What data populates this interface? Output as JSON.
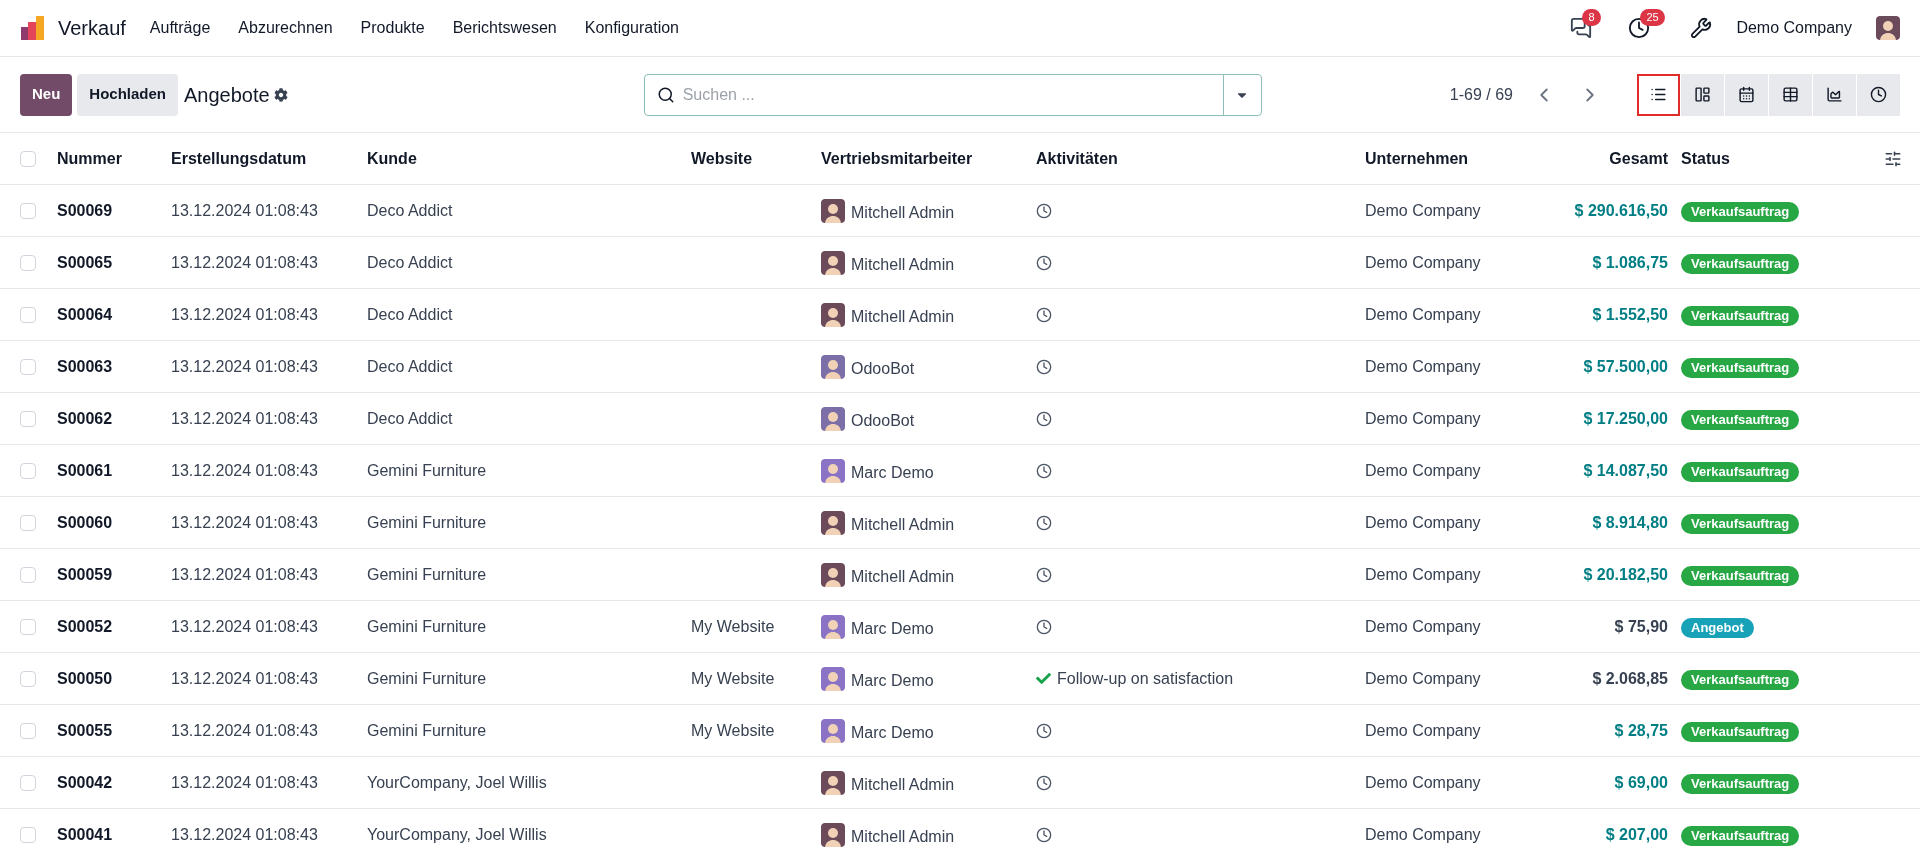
{
  "navbar": {
    "app_name": "Verkauf",
    "menu": [
      "Aufträge",
      "Abzurechnen",
      "Produkte",
      "Berichtswesen",
      "Konfiguration"
    ],
    "messages_badge": "8",
    "activities_badge": "25",
    "company": "Demo Company"
  },
  "control_panel": {
    "new_button": "Neu",
    "upload_button": "Hochladen",
    "title": "Angebote",
    "search": {
      "placeholder": "Suchen ..."
    },
    "pager": "1-69 / 69",
    "views": [
      {
        "kind": "list",
        "selected": true
      },
      {
        "kind": "kanban",
        "selected": false
      },
      {
        "kind": "calendar",
        "selected": false
      },
      {
        "kind": "pivot",
        "selected": false
      },
      {
        "kind": "graph",
        "selected": false
      },
      {
        "kind": "activity",
        "selected": false
      }
    ]
  },
  "table": {
    "select_all": {
      "checked": false
    },
    "columns": [
      "Nummer",
      "Erstellungsdatum",
      "Kunde",
      "Website",
      "Vertriebsmitarbeiter",
      "Aktivitäten",
      "Unternehmen",
      "Gesamt",
      "Status"
    ],
    "rows": [
      {
        "checked": false,
        "number": "S00069",
        "date": "13.12.2024 01:08:43",
        "customer": "Deco Addict",
        "website": "",
        "salesperson": "Mitchell Admin",
        "color": "#6b4a5a",
        "activity": {
          "kind": "clock"
        },
        "company": "Demo Company",
        "total": "$ 290.616,50",
        "highlighted": true,
        "status": {
          "kind": "sale",
          "label": "Verkaufsauftrag"
        }
      },
      {
        "checked": false,
        "number": "S00065",
        "date": "13.12.2024 01:08:43",
        "customer": "Deco Addict",
        "website": "",
        "salesperson": "Mitchell Admin",
        "color": "#6b4a5a",
        "activity": {
          "kind": "clock"
        },
        "company": "Demo Company",
        "total": "$ 1.086,75",
        "highlighted": true,
        "status": {
          "kind": "sale",
          "label": "Verkaufsauftrag"
        }
      },
      {
        "checked": false,
        "number": "S00064",
        "date": "13.12.2024 01:08:43",
        "customer": "Deco Addict",
        "website": "",
        "salesperson": "Mitchell Admin",
        "color": "#6b4a5a",
        "activity": {
          "kind": "clock"
        },
        "company": "Demo Company",
        "total": "$ 1.552,50",
        "highlighted": true,
        "status": {
          "kind": "sale",
          "label": "Verkaufsauftrag"
        }
      },
      {
        "checked": false,
        "number": "S00063",
        "date": "13.12.2024 01:08:43",
        "customer": "Deco Addict",
        "website": "",
        "salesperson": "OdooBot",
        "color": "#7c6fa8",
        "activity": {
          "kind": "clock"
        },
        "company": "Demo Company",
        "total": "$ 57.500,00",
        "highlighted": true,
        "status": {
          "kind": "sale",
          "label": "Verkaufsauftrag"
        }
      },
      {
        "checked": false,
        "number": "S00062",
        "date": "13.12.2024 01:08:43",
        "customer": "Deco Addict",
        "website": "",
        "salesperson": "OdooBot",
        "color": "#7c6fa8",
        "activity": {
          "kind": "clock"
        },
        "company": "Demo Company",
        "total": "$ 17.250,00",
        "highlighted": true,
        "status": {
          "kind": "sale",
          "label": "Verkaufsauftrag"
        }
      },
      {
        "checked": false,
        "number": "S00061",
        "date": "13.12.2024 01:08:43",
        "customer": "Gemini Furniture",
        "website": "",
        "salesperson": "Marc Demo",
        "color": "#8a72c4",
        "activity": {
          "kind": "clock"
        },
        "company": "Demo Company",
        "total": "$ 14.087,50",
        "highlighted": true,
        "status": {
          "kind": "sale",
          "label": "Verkaufsauftrag"
        }
      },
      {
        "checked": false,
        "number": "S00060",
        "date": "13.12.2024 01:08:43",
        "customer": "Gemini Furniture",
        "website": "",
        "salesperson": "Mitchell Admin",
        "color": "#6b4a5a",
        "activity": {
          "kind": "clock"
        },
        "company": "Demo Company",
        "total": "$ 8.914,80",
        "highlighted": true,
        "status": {
          "kind": "sale",
          "label": "Verkaufsauftrag"
        }
      },
      {
        "checked": false,
        "number": "S00059",
        "date": "13.12.2024 01:08:43",
        "customer": "Gemini Furniture",
        "website": "",
        "salesperson": "Mitchell Admin",
        "color": "#6b4a5a",
        "activity": {
          "kind": "clock"
        },
        "company": "Demo Company",
        "total": "$ 20.182,50",
        "highlighted": true,
        "status": {
          "kind": "sale",
          "label": "Verkaufsauftrag"
        }
      },
      {
        "checked": false,
        "number": "S00052",
        "date": "13.12.2024 01:08:43",
        "customer": "Gemini Furniture",
        "website": "My Website",
        "salesperson": "Marc Demo",
        "color": "#8a72c4",
        "activity": {
          "kind": "clock"
        },
        "company": "Demo Company",
        "total": "$ 75,90",
        "highlighted": false,
        "status": {
          "kind": "quotation",
          "label": "Angebot"
        }
      },
      {
        "checked": false,
        "number": "S00050",
        "date": "13.12.2024 01:08:43",
        "customer": "Gemini Furniture",
        "website": "My Website",
        "salesperson": "Marc Demo",
        "color": "#8a72c4",
        "activity": {
          "kind": "done",
          "label": "Follow-up on satisfaction"
        },
        "company": "Demo Company",
        "total": "$ 2.068,85",
        "highlighted": false,
        "status": {
          "kind": "sale",
          "label": "Verkaufsauftrag"
        }
      },
      {
        "checked": false,
        "number": "S00055",
        "date": "13.12.2024 01:08:43",
        "customer": "Gemini Furniture",
        "website": "My Website",
        "salesperson": "Marc Demo",
        "color": "#8a72c4",
        "activity": {
          "kind": "clock"
        },
        "company": "Demo Company",
        "total": "$ 28,75",
        "highlighted": true,
        "status": {
          "kind": "sale",
          "label": "Verkaufsauftrag"
        }
      },
      {
        "checked": false,
        "number": "S00042",
        "date": "13.12.2024 01:08:43",
        "customer": "YourCompany, Joel Willis",
        "website": "",
        "salesperson": "Mitchell Admin",
        "color": "#6b4a5a",
        "activity": {
          "kind": "clock"
        },
        "company": "Demo Company",
        "total": "$ 69,00",
        "highlighted": true,
        "status": {
          "kind": "sale",
          "label": "Verkaufsauftrag"
        }
      },
      {
        "checked": false,
        "number": "S00041",
        "date": "13.12.2024 01:08:43",
        "customer": "YourCompany, Joel Willis",
        "website": "",
        "salesperson": "Mitchell Admin",
        "color": "#6b4a5a",
        "activity": {
          "kind": "clock"
        },
        "company": "Demo Company",
        "total": "$ 207,00",
        "highlighted": true,
        "status": {
          "kind": "sale",
          "label": "Verkaufsauftrag"
        }
      }
    ]
  }
}
